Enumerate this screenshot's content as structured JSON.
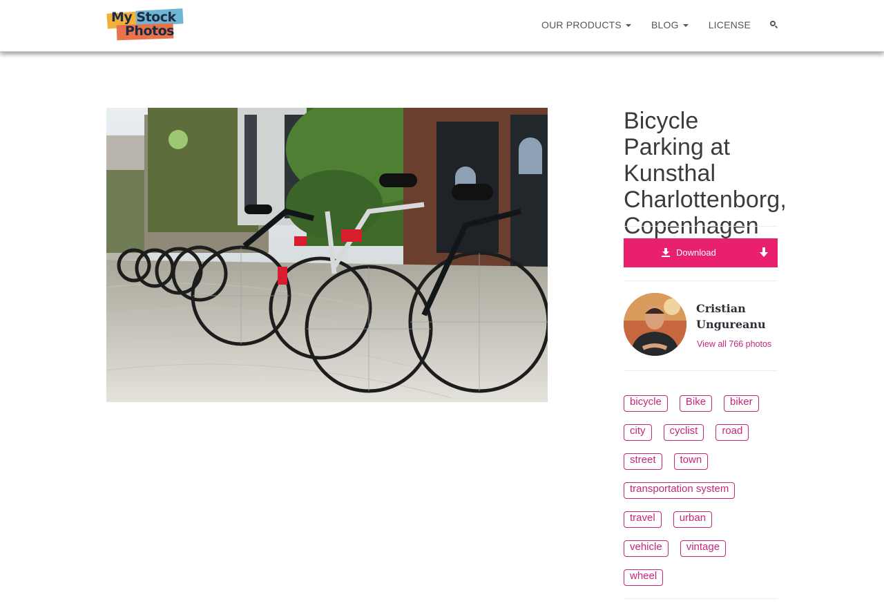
{
  "brand": {
    "logo_line1": "My Stock",
    "logo_line2": "Photos"
  },
  "nav": {
    "products": "OUR PRODUCTS",
    "blog": "BLOG",
    "license": "LICENSE",
    "search_icon": "search-icon"
  },
  "photo": {
    "alt": "Bicycles parked on cobblestones in front of an ivy-covered building"
  },
  "sidebar": {
    "title": "Bicycle Parking at Kunsthal Charlottenborg, Copenhagen",
    "download_label": "Download",
    "author_name": "Cristian Ungureanu",
    "author_link": "View all 766 photos",
    "tags": [
      [
        "bicycle",
        "Bike",
        "biker"
      ],
      [
        "city",
        "cyclist",
        "road"
      ],
      [
        "street",
        "town"
      ],
      [
        "transportation system"
      ],
      [
        "travel",
        "urban"
      ],
      [
        "vehicle",
        "vintage"
      ],
      [
        "wheel"
      ]
    ]
  },
  "colors": {
    "accent": "#e9206e",
    "tag": "#c2277a",
    "title": "#3b3b3b"
  }
}
